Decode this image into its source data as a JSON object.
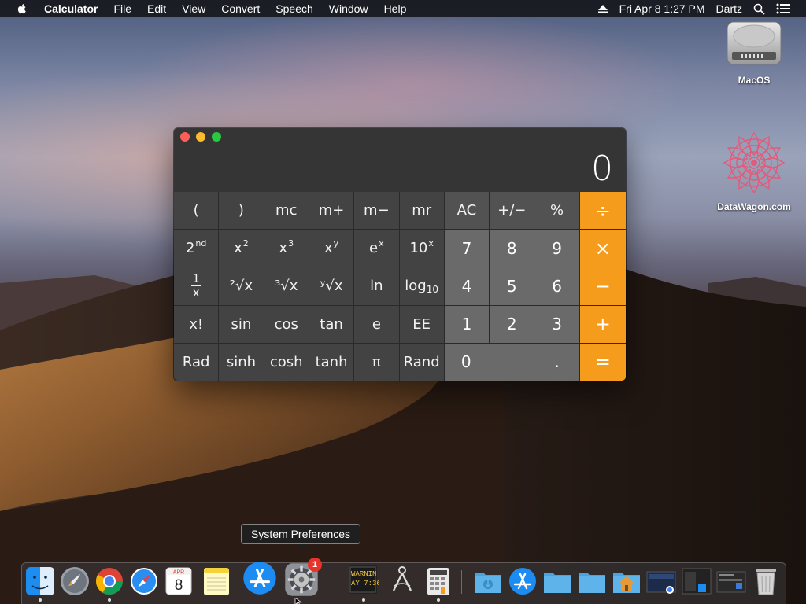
{
  "menubar": {
    "app_name": "Calculator",
    "items": [
      "File",
      "Edit",
      "View",
      "Convert",
      "Speech",
      "Window",
      "Help"
    ],
    "datetime": "Fri Apr 8  1:27 PM",
    "user": "Dartz"
  },
  "desktop": {
    "icons": [
      {
        "label": "MacOS",
        "icon": "hard-drive-icon"
      },
      {
        "label": "DataWagon.com",
        "icon": "mandala-icon"
      }
    ]
  },
  "calculator": {
    "display": "0",
    "keys": {
      "paren_open": "(",
      "paren_close": ")",
      "mc": "mc",
      "m_plus": "m+",
      "m_minus": "m−",
      "mr": "mr",
      "ac": "AC",
      "plus_minus": "+/−",
      "percent": "%",
      "divide": "÷",
      "second": "2",
      "second_sup": "nd",
      "x_sq": "x",
      "x_sq_sup": "2",
      "x_cube": "x",
      "x_cube_sup": "3",
      "x_y": "x",
      "x_y_sup": "y",
      "e_x": "e",
      "e_x_sup": "x",
      "ten_x": "10",
      "ten_x_sup": "x",
      "n7": "7",
      "n8": "8",
      "n9": "9",
      "multiply": "×",
      "frac_num": "1",
      "frac_den": "x",
      "sqrt2": "²√x",
      "sqrt3": "³√x",
      "sqrty": "ʸ√x",
      "ln": "ln",
      "log": "log",
      "log_sub": "10",
      "n4": "4",
      "n5": "5",
      "n6": "6",
      "minus": "−",
      "fact": "x!",
      "sin": "sin",
      "cos": "cos",
      "tan": "tan",
      "e": "e",
      "ee": "EE",
      "n1": "1",
      "n2": "2",
      "n3": "3",
      "plus": "+",
      "rad": "Rad",
      "sinh": "sinh",
      "cosh": "cosh",
      "tanh": "tanh",
      "pi": "π",
      "rand": "Rand",
      "n0": "0",
      "dot": ".",
      "equals": "="
    }
  },
  "tooltip": "System Preferences",
  "dock": {
    "items": [
      "Finder",
      "Launchpad",
      "Google Chrome",
      "Safari",
      "Calendar",
      "Notes",
      "App Store",
      "System Preferences",
      "Console",
      "Directory Utility",
      "Calculator",
      "Downloads",
      "App Store Folder",
      "Folder",
      "Folder",
      "Home",
      "Screenshot",
      "Screenshot",
      "Screenshot",
      "Trash"
    ],
    "calendar_month": "APR",
    "calendar_day": "8",
    "console_text_1": "WARNIN",
    "console_text_2": "AY 7:36",
    "badge": "1"
  },
  "colors": {
    "operator": "#f59c1c",
    "number_key": "#6a6a6a",
    "function_key": "#434343",
    "window_bg": "#353535"
  }
}
